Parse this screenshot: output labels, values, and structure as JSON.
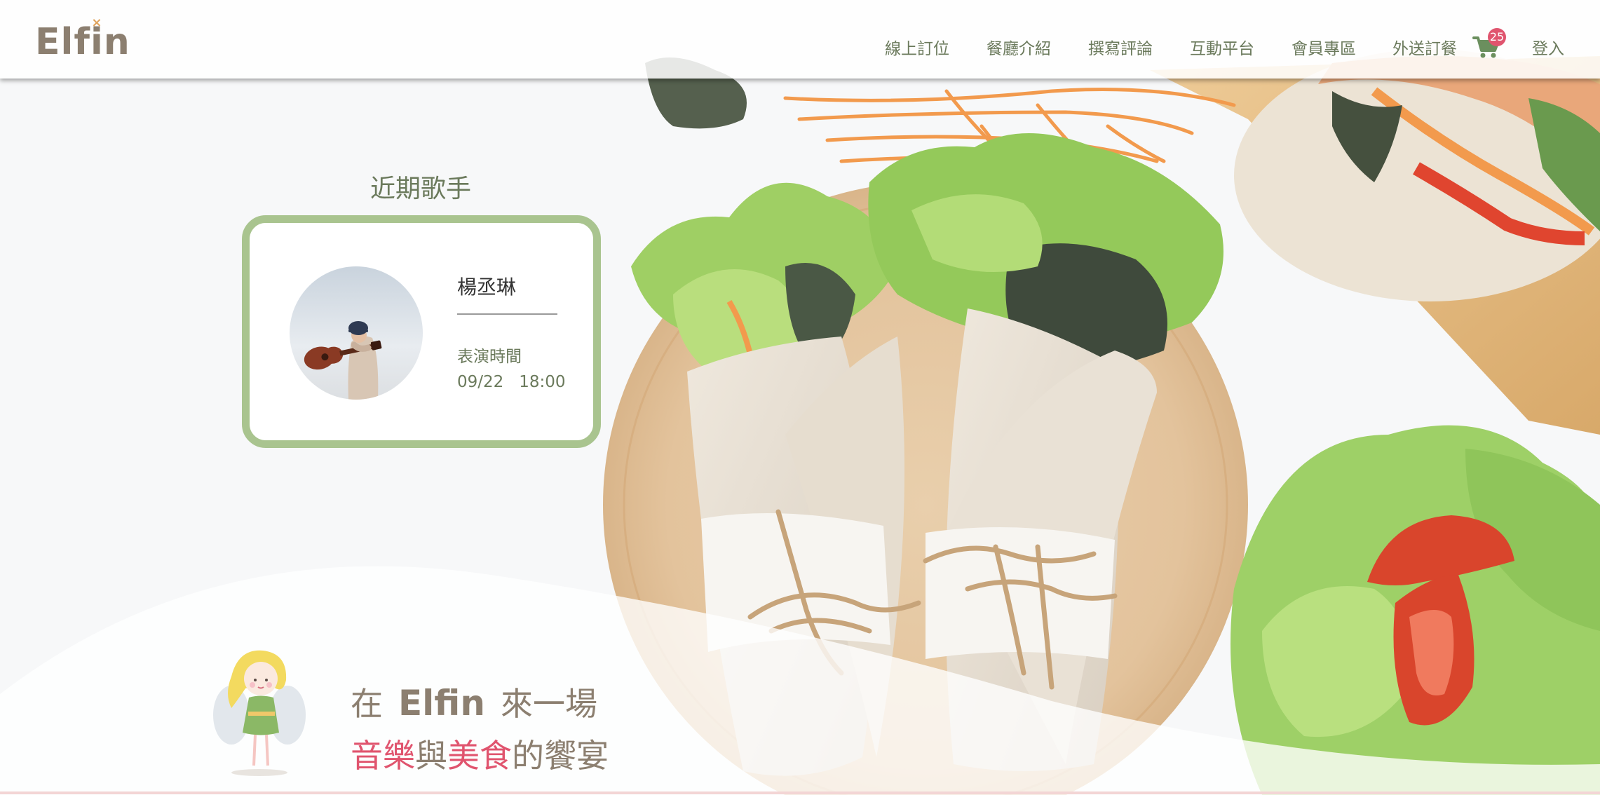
{
  "brand": {
    "logo_text_pre": "Elf",
    "logo_text_i": "i",
    "logo_text_post": "n",
    "logo_mark": "×"
  },
  "nav": {
    "items": [
      {
        "label": "線上訂位"
      },
      {
        "label": "餐廳介紹"
      },
      {
        "label": "撰寫評論"
      },
      {
        "label": "互動平台"
      },
      {
        "label": "會員專區"
      },
      {
        "label": "外送訂餐"
      }
    ],
    "cart_icon": "shopping-cart-icon",
    "cart_count": "25",
    "login_label": "登入"
  },
  "singers": {
    "section_title": "近期歌手",
    "card": {
      "name": "楊丞琳",
      "performance_label": "表演時間",
      "performance_date": "09/22",
      "performance_time": "18:00"
    }
  },
  "slogan": {
    "line1_pre": "在",
    "line1_brand": "Elfin",
    "line1_post": "來一場",
    "line2_part1": "音樂",
    "line2_part2": "與",
    "line2_part3": "美食",
    "line2_part4": "的饗宴"
  },
  "colors": {
    "brand": "#8c7f70",
    "nav_text": "#6b7a5c",
    "card_border": "#a9c48f",
    "accent_pink": "#e0546e",
    "cart_green": "#6b8f5e"
  }
}
